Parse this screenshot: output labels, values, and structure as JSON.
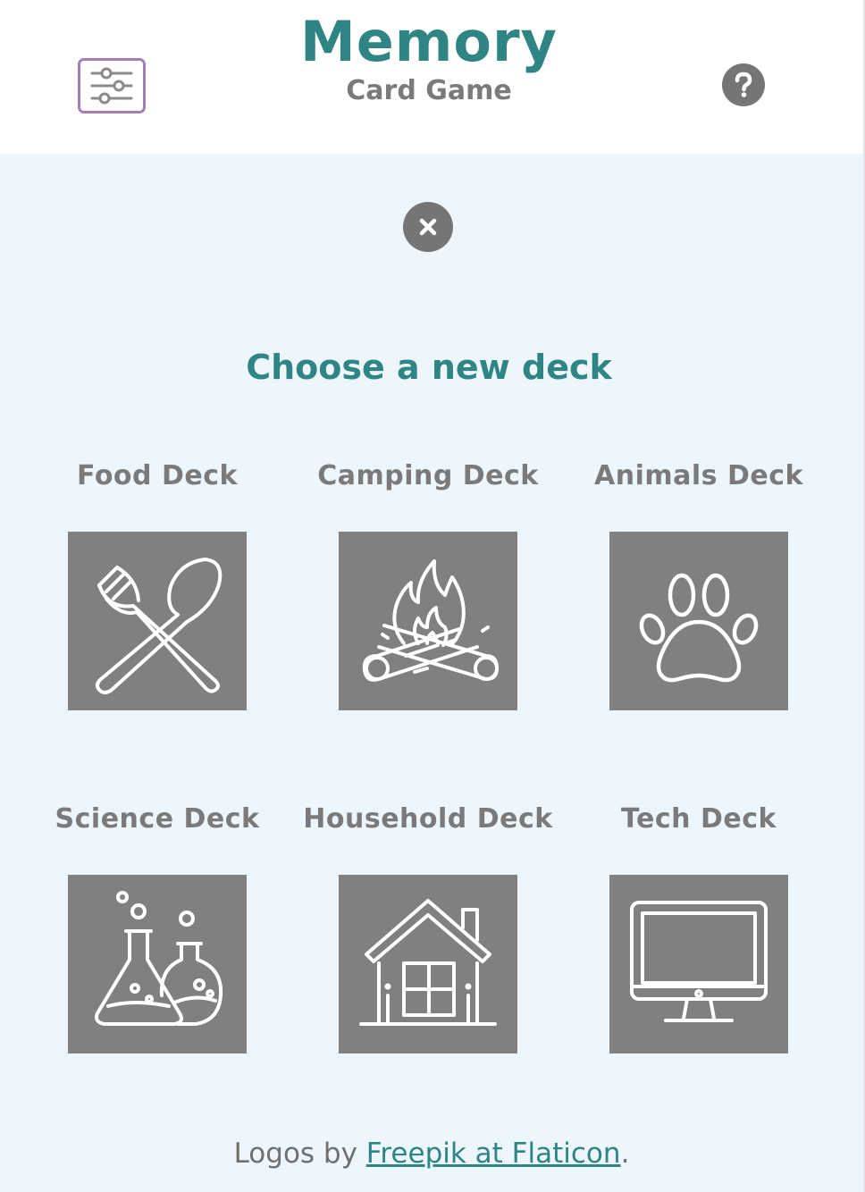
{
  "header": {
    "title": "Memory",
    "subtitle": "Card Game",
    "settings_icon": "sliders-icon",
    "help_icon": "question-icon"
  },
  "main": {
    "close_icon": "close-icon",
    "heading": "Choose a new deck",
    "decks": [
      {
        "label": "Food Deck",
        "icon": "fork-spoon-icon"
      },
      {
        "label": "Camping Deck",
        "icon": "campfire-icon"
      },
      {
        "label": "Animals Deck",
        "icon": "paw-icon"
      },
      {
        "label": "Science Deck",
        "icon": "flasks-icon"
      },
      {
        "label": "Household Deck",
        "icon": "house-icon"
      },
      {
        "label": "Tech Deck",
        "icon": "monitor-icon"
      }
    ]
  },
  "footer": {
    "prefix": "Logos by ",
    "link_text": "Freepik at Flaticon",
    "suffix": "."
  },
  "colors": {
    "accent": "#2e8583",
    "label_gray": "#7a7a7a",
    "tile_gray": "#808080",
    "background": "#eef6fd",
    "settings_border": "#a57bb8"
  }
}
